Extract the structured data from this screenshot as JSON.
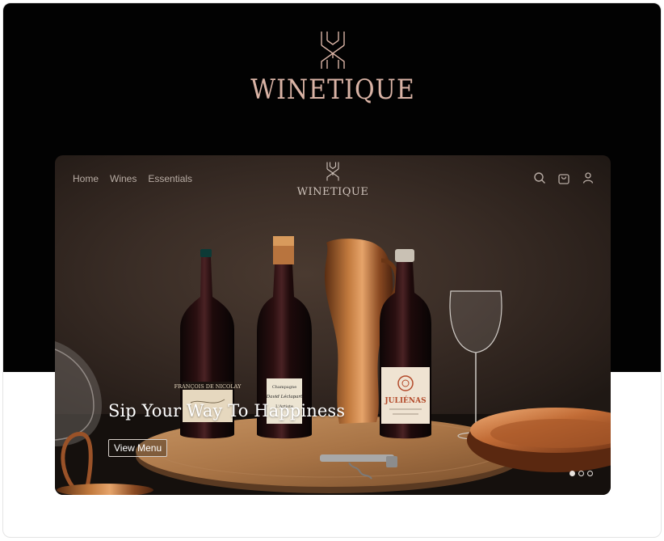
{
  "brand": {
    "name": "WINETIQUE",
    "color": "#d9b3a5"
  },
  "hero": {
    "nav": [
      {
        "label": "Home"
      },
      {
        "label": "Wines"
      },
      {
        "label": "Essentials"
      }
    ],
    "logo_text": "WINETIQUE",
    "icons": [
      "search-icon",
      "cart-icon",
      "user-icon"
    ],
    "headline": "Sip Your Way To Happiness",
    "cta_label": "View Menu",
    "slides": {
      "count": 3,
      "active": 1
    },
    "labels": {
      "bottle1": "FRANÇOIS DE NICOLAY",
      "bottle2_top": "Champagne",
      "bottle2_name": "David Léclapart",
      "bottle2_sub": "L'Artiste",
      "bottle3": "JULIÉNAS"
    }
  }
}
